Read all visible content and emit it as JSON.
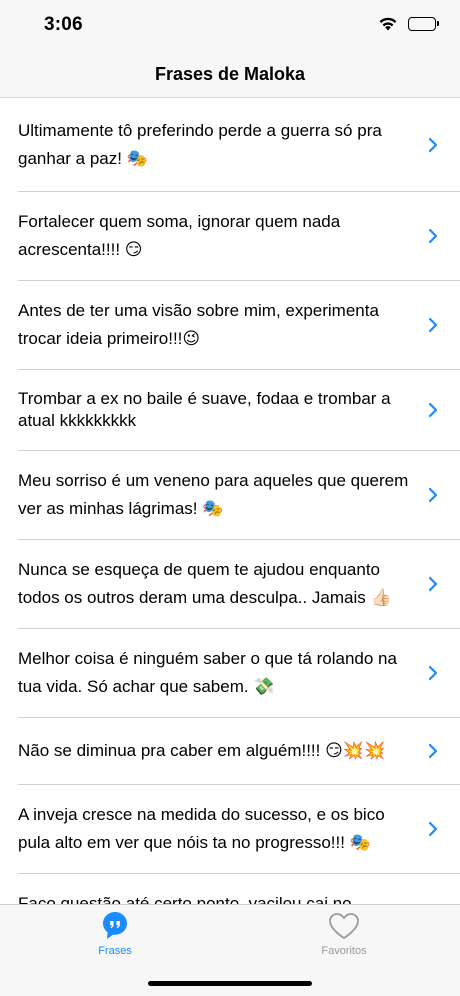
{
  "status_bar": {
    "time": "3:06",
    "wifi_icon": "wifi-icon",
    "battery_icon": "battery-icon"
  },
  "nav": {
    "title": "Frases de Maloka"
  },
  "list": {
    "items": [
      {
        "text": "Ultimamente tô preferindo perde a guerra só pra ganhar a paz! 🎭"
      },
      {
        "text": "Fortalecer quem soma, ignorar quem nada acrescenta!!!! 😏"
      },
      {
        "text": "Antes de ter uma visão sobre mim, experimenta trocar ideia primeiro!!!😉"
      },
      {
        "text": "Trombar a ex no baile é suave, fodaa e trombar a atual kkkkkkkkk"
      },
      {
        "text": "Meu sorriso é um veneno para aqueles que querem ver as minhas lágrimas! 🎭"
      },
      {
        "text": "Nunca se esqueça de quem te ajudou enquanto todos os outros deram uma desculpa.. Jamais 👍🏻"
      },
      {
        "text": "Melhor coisa é ninguém saber o que tá rolando na tua vida. Só achar que sabem. 💸"
      },
      {
        "text": "Não se diminua pra caber em alguém!!!! 😏💥💥"
      },
      {
        "text": "A inveja cresce na medida do sucesso, e os bico pula alto em ver que nóis ta no progresso!!! 🎭"
      },
      {
        "text": "Faço questão até certo ponto, vacilou cai no conceito"
      }
    ]
  },
  "tab_bar": {
    "tabs": [
      {
        "label": "Frases",
        "icon": "quote-bubble-icon",
        "active": true
      },
      {
        "label": "Favoritos",
        "icon": "heart-icon",
        "active": false
      }
    ]
  },
  "colors": {
    "accent": "#1a8cff",
    "inactive": "#9a9a9a",
    "separator": "#d0d0d0",
    "bar_bg": "#f7f7f7"
  }
}
